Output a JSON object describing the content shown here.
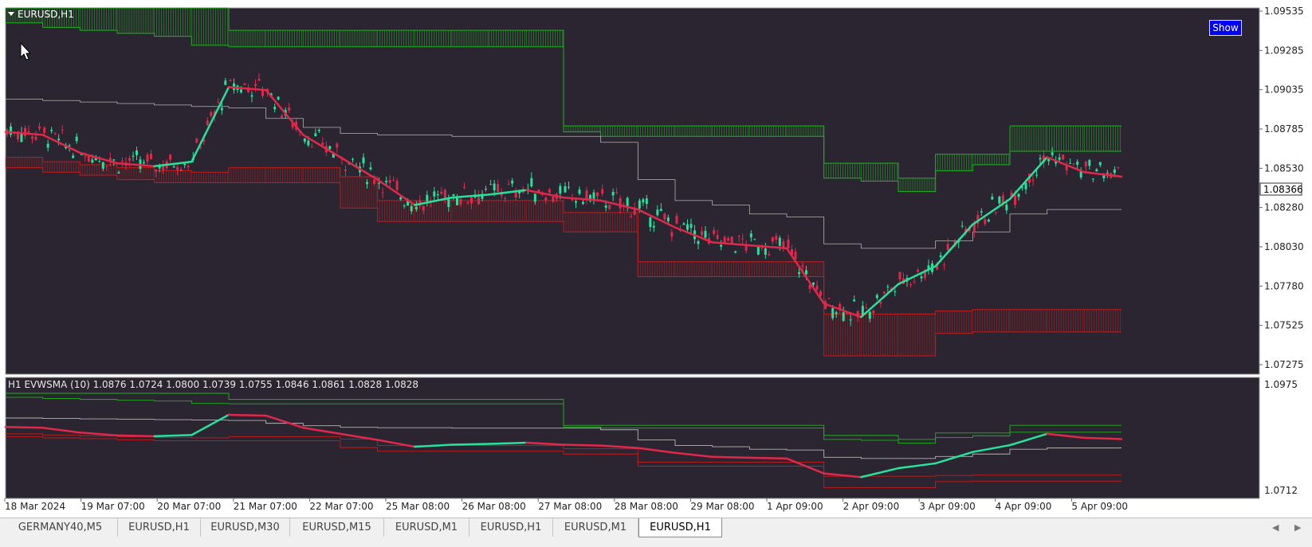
{
  "window": {
    "symbol_label": "EURUSD,H1",
    "show_button": "Show"
  },
  "colors": {
    "background": "#2a2530",
    "bull": "#26e29a",
    "bear": "#e0294a",
    "upper_band": "#1cb51c",
    "lower_band": "#c41c1c",
    "mid_line": "#b4b4b4",
    "price_tag_bg": "#ffffff"
  },
  "price_scale": {
    "labels": [
      "1.09535",
      "1.09285",
      "1.09035",
      "1.08785",
      "1.08530",
      "1.08280",
      "1.08030",
      "1.07780",
      "1.07525",
      "1.07275"
    ],
    "current_price": "1.08366"
  },
  "indicator": {
    "label": "H1 EVWSMA (10) 1.0876 1.0724 1.0800 1.0739 1.0755 1.0846 1.0861 1.0828 1.0828",
    "scale_labels": [
      "1.0975",
      "1.0712"
    ]
  },
  "time_axis": {
    "labels": [
      "18 Mar 2024",
      "19 Mar 07:00",
      "20 Mar 07:00",
      "21 Mar 07:00",
      "22 Mar 07:00",
      "25 Mar 08:00",
      "26 Mar 08:00",
      "27 Mar 08:00",
      "28 Mar 08:00",
      "29 Mar 08:00",
      "1 Apr 09:00",
      "2 Apr 09:00",
      "3 Apr 09:00",
      "4 Apr 09:00",
      "5 Apr 09:00"
    ]
  },
  "tabs": [
    {
      "label": "GERMANY40,M5",
      "active": false
    },
    {
      "label": "EURUSD,H1",
      "active": false
    },
    {
      "label": "EURUSD,M30",
      "active": false
    },
    {
      "label": "EURUSD,M15",
      "active": false
    },
    {
      "label": "EURUSD,M1",
      "active": false
    },
    {
      "label": "EURUSD,H1",
      "active": false
    },
    {
      "label": "EURUSD,M1",
      "active": false
    },
    {
      "label": "EURUSD,H1",
      "active": true
    }
  ],
  "tab_nav": {
    "left": "◀",
    "right": "▶"
  },
  "chart_data": [
    {
      "type": "line",
      "title": "EURUSD,H1",
      "xlabel": "",
      "ylabel": "",
      "ylim": [
        1.0715,
        1.0955
      ],
      "x": [
        0,
        45,
        90,
        135,
        180,
        225,
        270,
        315,
        360,
        405,
        450,
        495,
        540,
        585,
        630,
        675,
        720,
        765,
        810,
        855,
        900,
        945,
        990,
        1035,
        1080,
        1125,
        1170,
        1215,
        1260,
        1305,
        1350
      ],
      "series": [
        {
          "name": "",
          "role": "mid",
          "values": [
            1.0894,
            1.0893,
            1.0892,
            1.0891,
            1.089,
            1.0889,
            1.0888,
            1.0881,
            1.0875,
            1.0871,
            1.087,
            1.087,
            1.0869,
            1.0869,
            1.0869,
            1.0869,
            1.0865,
            1.084,
            1.0826,
            1.0823,
            1.0817,
            1.0815,
            1.0797,
            1.0794,
            1.0794,
            1.0799,
            1.0805,
            1.0817,
            1.082,
            1.082,
            1.082
          ]
        },
        {
          "name": "",
          "role": "ewsma",
          "values": [
            1.0872,
            1.087,
            1.0858,
            1.0851,
            1.0849,
            1.0852,
            1.0902,
            1.09,
            1.087,
            1.0855,
            1.084,
            1.0823,
            1.0828,
            1.083,
            1.0833,
            1.0828,
            1.0826,
            1.082,
            1.0808,
            1.0798,
            1.0796,
            1.0794,
            1.0757,
            1.0748,
            1.077,
            1.0782,
            1.081,
            1.0827,
            1.0855,
            1.0845,
            1.0842
          ]
        },
        {
          "name": "",
          "role": "upper_outer",
          "values": [
            1.0955,
            1.0955,
            1.0955,
            1.0955,
            1.0955,
            1.0955,
            1.094,
            1.094,
            1.094,
            1.094,
            1.094,
            1.094,
            1.094,
            1.094,
            1.094,
            1.0876,
            1.0876,
            1.0876,
            1.0876,
            1.0876,
            1.0876,
            1.0876,
            1.0851,
            1.0851,
            1.0841,
            1.0857,
            1.0857,
            1.0876,
            1.0876,
            1.0876,
            1.0876
          ]
        },
        {
          "name": "",
          "role": "upper_inner",
          "values": [
            1.0945,
            1.0942,
            1.094,
            1.0938,
            1.0936,
            1.093,
            1.0929,
            1.0929,
            1.0929,
            1.0929,
            1.0929,
            1.0929,
            1.0929,
            1.0929,
            1.0929,
            1.0872,
            1.0869,
            1.0869,
            1.0869,
            1.0869,
            1.0869,
            1.0869,
            1.0841,
            1.0839,
            1.0832,
            1.0846,
            1.085,
            1.0859,
            1.0859,
            1.0859,
            1.0859
          ]
        },
        {
          "name": "",
          "role": "lower_inner",
          "values": [
            1.0855,
            1.0852,
            1.085,
            1.0848,
            1.0846,
            1.0845,
            1.0848,
            1.0848,
            1.0848,
            1.0842,
            1.0826,
            1.0826,
            1.0826,
            1.0826,
            1.0826,
            1.0818,
            1.0818,
            1.0785,
            1.0785,
            1.0785,
            1.0785,
            1.0785,
            1.075,
            1.075,
            1.075,
            1.0752,
            1.0753,
            1.0753,
            1.0753,
            1.0753,
            1.0753
          ]
        },
        {
          "name": "",
          "role": "lower_outer",
          "values": [
            1.0848,
            1.0845,
            1.0843,
            1.084,
            1.0838,
            1.0838,
            1.0838,
            1.0838,
            1.0838,
            1.0821,
            1.0812,
            1.0812,
            1.0812,
            1.0812,
            1.0812,
            1.0805,
            1.0805,
            1.0775,
            1.0775,
            1.0775,
            1.0775,
            1.0775,
            1.0722,
            1.0722,
            1.0722,
            1.0737,
            1.0738,
            1.0738,
            1.0738,
            1.0738,
            1.0738
          ]
        }
      ]
    }
  ]
}
